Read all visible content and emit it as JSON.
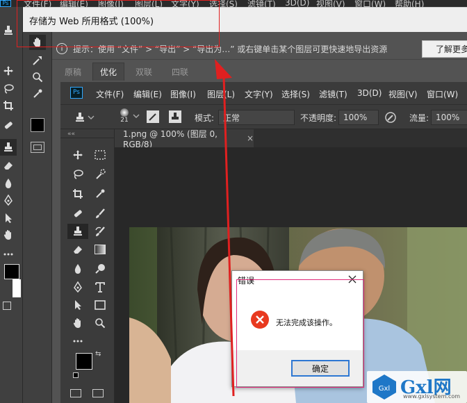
{
  "outer_ps": {
    "logo": "Ps",
    "menu": [
      "文件(F)",
      "编辑(E)",
      "图像(I)",
      "图层(L)",
      "文字(Y)",
      "选择(S)",
      "滤镜(T)",
      "3D(D)",
      "视图(V)",
      "窗口(W)",
      "帮助(H)"
    ]
  },
  "save_for_web": {
    "title": "存储为 Web 所用格式 (100%)",
    "info_text": "提示：使用 “文件” > “导出” > “导出为…” 或右键单击某个图层可更快速地导出资源",
    "learn_more_label": "了解更多",
    "view_tabs": [
      "原稿",
      "优化",
      "双联",
      "四联"
    ],
    "active_tab": "优化"
  },
  "inner_ps": {
    "logo": "Ps",
    "menu": [
      "文件(F)",
      "编辑(E)",
      "图像(I)",
      "图层(L)",
      "文字(Y)",
      "选择(S)",
      "滤镜(T)",
      "3D(D)",
      "视图(V)",
      "窗口(W)"
    ],
    "options": {
      "brush_size": "21",
      "mode_label": "模式:",
      "mode_value": "正常",
      "opacity_label": "不透明度:",
      "opacity_value": "100%",
      "flow_label": "流量:",
      "flow_value": "100%"
    },
    "collapse_glyph": "««",
    "document_tab": "1.png @ 100% (图层 0, RGB/8)",
    "close_glyph": "×"
  },
  "error_dialog": {
    "title": "错误",
    "message": "无法完成该操作。",
    "ok_label": "确定",
    "close_glyph": "✕"
  },
  "watermark": {
    "text": "Gxl网",
    "sub": "www.gxlsystem.com"
  },
  "colors": {
    "accent_red": "#e02020",
    "ps_blue": "#31a8ff",
    "error_red": "#e8391f",
    "ok_border": "#2d77d3"
  }
}
